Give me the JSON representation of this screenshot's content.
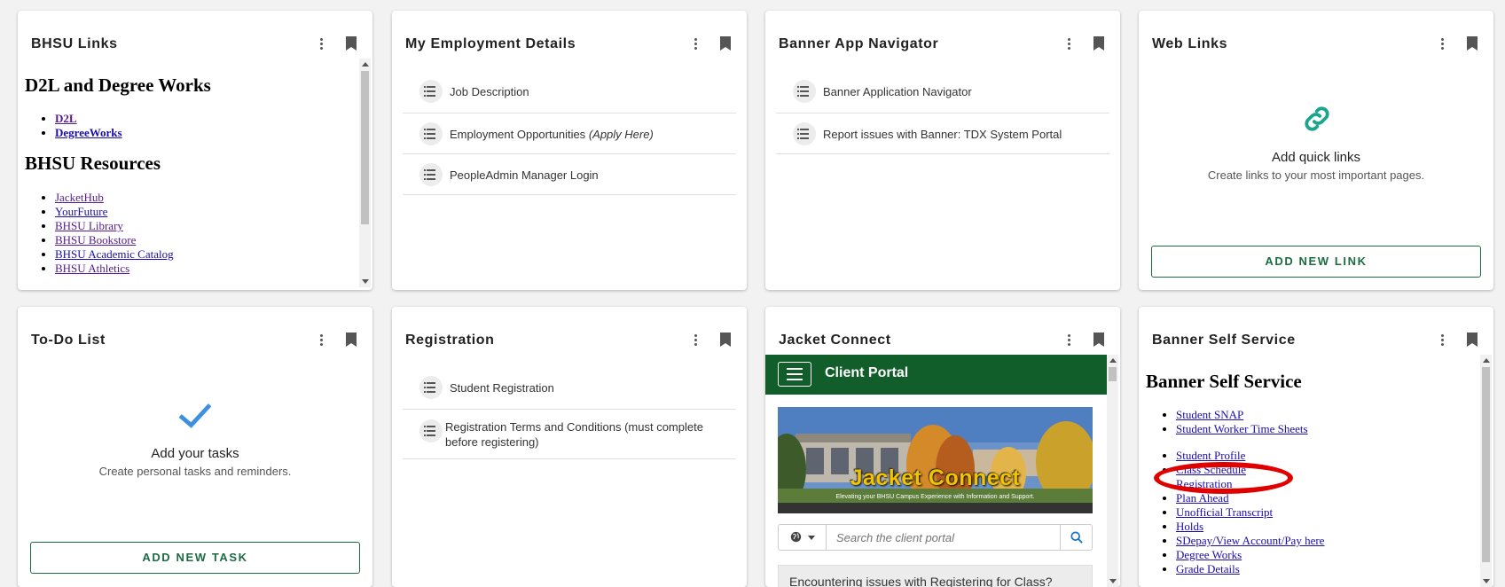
{
  "cards": {
    "bhsu_links": {
      "title": "BHSU Links",
      "heading1": "D2L and Degree Works",
      "links1": [
        "D2L",
        "DegreeWorks"
      ],
      "heading2": "BHSU Resources",
      "links2": [
        "JacketHub",
        "YourFuture",
        "BHSU Library",
        "BHSU Bookstore",
        "BHSU Academic Catalog",
        "BHSU Athletics"
      ]
    },
    "employment": {
      "title": "My Employment Details",
      "items": [
        "Job Description",
        "Employment Opportunities",
        "PeopleAdmin Manager Login"
      ],
      "apply_note": "(Apply Here)"
    },
    "banner_nav": {
      "title": "Banner App Navigator",
      "items": [
        "Banner Application Navigator",
        "Report issues with Banner: TDX System Portal"
      ]
    },
    "web_links": {
      "title": "Web Links",
      "empty_title": "Add quick links",
      "empty_sub": "Create links to your most important pages.",
      "button": "ADD NEW LINK"
    },
    "todo": {
      "title": "To-Do List",
      "empty_title": "Add your tasks",
      "empty_sub": "Create personal tasks and reminders.",
      "button": "ADD NEW TASK"
    },
    "registration": {
      "title": "Registration",
      "items": [
        "Student Registration",
        "Registration Terms and Conditions (must complete",
        "before registering)"
      ]
    },
    "jacket_connect": {
      "title": "Jacket Connect",
      "portal_title": "Client Portal",
      "banner_text": "Jacket Connect",
      "banner_tagline": "Elevating your BHSU Campus Experience with Information and Support.",
      "search_placeholder": "Search the client portal",
      "notice": "Encountering issues with Registering for Class?"
    },
    "banner_self_service": {
      "title": "Banner Self Service",
      "heading": "Banner Self Service",
      "links_top": [
        "Student SNAP",
        "Student Worker Time Sheets"
      ],
      "links": [
        "Student Profile",
        "Class Schedule",
        "Registration",
        "Plan Ahead",
        "Unofficial Transcript",
        "Holds",
        "SDepay/View Account/Pay here",
        "Degree Works",
        "Grade Details"
      ]
    }
  },
  "colors": {
    "accent_green": "#1d6b43",
    "portal_green": "#115e2b",
    "teal_link_icon": "#1aa68c",
    "check_blue": "#3d8fe0",
    "annotation_red": "#e00000"
  }
}
